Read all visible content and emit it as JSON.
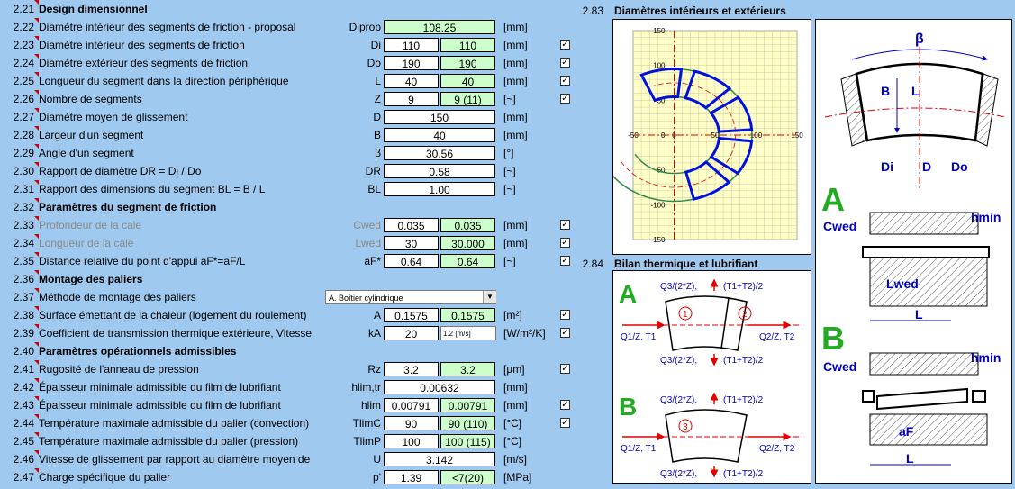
{
  "rows": [
    {
      "num": "2.21",
      "label": "Design dimensionnel",
      "header": true
    },
    {
      "num": "2.22",
      "label": "Diamètre intérieur des segments de friction - proposal",
      "sym": "Diprop",
      "merged": "108.25",
      "merged_style": "g",
      "unit": "[mm]"
    },
    {
      "num": "2.23",
      "label": "Diamètre intérieur des segments de friction",
      "sym": "Di",
      "v1": "110",
      "v2": "110",
      "unit": "[mm]",
      "check": true
    },
    {
      "num": "2.24",
      "label": "Diamètre extérieur des segments de friction",
      "sym": "Do",
      "v1": "190",
      "v2": "190",
      "unit": "[mm]",
      "check": true
    },
    {
      "num": "2.25",
      "label": "Longueur du segment dans la direction périphérique",
      "sym": "L",
      "v1": "40",
      "v2": "40",
      "unit": "[mm]",
      "check": true
    },
    {
      "num": "2.26",
      "label": "Nombre de segments",
      "sym": "Z",
      "v1": "9",
      "v2": "9  (11)",
      "unit": "[~]",
      "check": true
    },
    {
      "num": "2.27",
      "label": "Diamètre moyen de glissement",
      "sym": "D",
      "merged": "150",
      "merged_style": "w",
      "unit": "[mm]"
    },
    {
      "num": "2.28",
      "label": "Largeur d'un segment",
      "sym": "B",
      "merged": "40",
      "merged_style": "w",
      "unit": "[mm]"
    },
    {
      "num": "2.29",
      "label": "Angle d'un segment",
      "sym": "β",
      "merged": "30.56",
      "merged_style": "w",
      "unit": "[°]"
    },
    {
      "num": "2.30",
      "label": "Rapport de diamètre DR = Di / Do",
      "sym": "DR",
      "merged": "0.58",
      "merged_style": "w",
      "unit": "[~]"
    },
    {
      "num": "2.31",
      "label": "Rapport des dimensions du segment BL = B / L",
      "sym": "BL",
      "merged": "1.00",
      "merged_style": "w",
      "unit": "[~]"
    },
    {
      "num": "2.32",
      "label": "Paramètres du segment de friction",
      "header": true
    },
    {
      "num": "2.33",
      "label": "Profondeur de la cale",
      "sym": "Cwed",
      "v1": "0.035",
      "v2": "0.035",
      "unit": "[mm]",
      "check": true,
      "gray": true
    },
    {
      "num": "2.34",
      "label": "Longueur de la cale",
      "sym": "Lwed",
      "v1": "30",
      "v2": "30.000",
      "unit": "[mm]",
      "check": true,
      "gray": true
    },
    {
      "num": "2.35",
      "label": "Distance relative du point d'appui aF*=aF/L",
      "sym": "aF*",
      "v1": "0.64",
      "v2": "0.64",
      "unit": "[~]",
      "check": true
    },
    {
      "num": "2.36",
      "label": "Montage des paliers",
      "header": true
    },
    {
      "num": "2.37",
      "label": "Méthode de montage des paliers",
      "select": "A. Boîtier cylindrique"
    },
    {
      "num": "2.38",
      "label": "Surface émettant de la chaleur (logement du roulement)",
      "sym": "A",
      "v1": "0.1575",
      "v2": "0.1575",
      "unit": "[m²]",
      "check": true
    },
    {
      "num": "2.39",
      "label": "Coefficient de transmission thermique extérieure, Vitesse",
      "sym": "kA",
      "v1": "20",
      "mini": "1.2 [m/s]",
      "unit": "[W/m²/K]",
      "check": true
    },
    {
      "num": "2.40",
      "label": "Paramètres opérationnels admissibles",
      "header": true
    },
    {
      "num": "2.41",
      "label": "Rugosité de l'anneau de pression",
      "sym": "Rz",
      "v1": "3.2",
      "v2": "3.2",
      "unit": "[µm]",
      "check": true
    },
    {
      "num": "2.42",
      "label": "Épaisseur minimale admissible du film de lubrifiant",
      "sym": "hlim,tr",
      "merged": "0.00632",
      "merged_style": "w",
      "unit": "[mm]"
    },
    {
      "num": "2.43",
      "label": "Épaisseur minimale admissible du film de lubrifiant",
      "sym": "hlim",
      "v1": "0.00791",
      "v2": "0.00791",
      "unit": "[mm]",
      "check": true
    },
    {
      "num": "2.44",
      "label": "Température maximale admissible du palier (convection)",
      "sym": "TlimC",
      "v1": "90",
      "v2": "90 (110)",
      "unit": "[°C]",
      "check": true
    },
    {
      "num": "2.45",
      "label": "Température maximale admissible du palier (pression)",
      "sym": "TlimP",
      "v1": "100",
      "v2": "100 (115)",
      "unit": "[°C]"
    },
    {
      "num": "2.46",
      "label": "Vitesse de glissement par rapport au diamètre moyen de",
      "sym": "U",
      "merged": "3.142",
      "merged_style": "w",
      "unit": "[m/s]"
    },
    {
      "num": "2.47",
      "label": "Charge spécifique du palier",
      "sym": "p'",
      "v1": "1.39",
      "v2": "<7(20)",
      "unit": "[MPa]"
    }
  ],
  "panel283": {
    "num": "2.83",
    "title": "Diamètres intérieurs et extérieurs"
  },
  "panel284": {
    "num": "2.84",
    "title": "Bilan thermique et lubrifiant"
  },
  "chart_data": {
    "type": "line",
    "title": "",
    "xlabel": "",
    "ylabel": "",
    "xlim": [
      -50,
      150
    ],
    "ylim": [
      -150,
      150
    ],
    "x_ticks": [
      "-50",
      "0",
      "50",
      "100",
      "150"
    ],
    "y_ticks": [
      "150",
      "100",
      "50",
      "0",
      "-50",
      "-100",
      "-150"
    ],
    "inner_diameter": 110,
    "outer_diameter": 190,
    "segments": 5,
    "segment_angle_deg": 30.56,
    "grid": true,
    "colors": {
      "segments": "#0010e0",
      "axes": "#e00000",
      "arcs": "#2a8a4a",
      "background": "#ffffc6"
    }
  },
  "diagram_labels": {
    "beta": "β",
    "B": "B",
    "L": "L",
    "Di": "Di",
    "D": "D",
    "Do": "Do",
    "A": "A",
    "B2": "B",
    "Cwed": "Cwed",
    "hmin": "hmin",
    "Lwed": "Lwed",
    "aF": "aF",
    "q_top": "Q3/(2*Z),",
    "t_top": "(T1+T2)/2",
    "q_in": "Q1/Z, T1",
    "q_out": "Q2/Z, T2",
    "c1": "1",
    "c2": "2",
    "c3": "3"
  },
  "colors": {
    "background": "#9fc9ef",
    "input_green": "#ccffcc",
    "header_red": "#d00000",
    "big_letter_green": "#22aa22",
    "arrow_red": "#e00000",
    "text_blue": "#0000c0"
  }
}
